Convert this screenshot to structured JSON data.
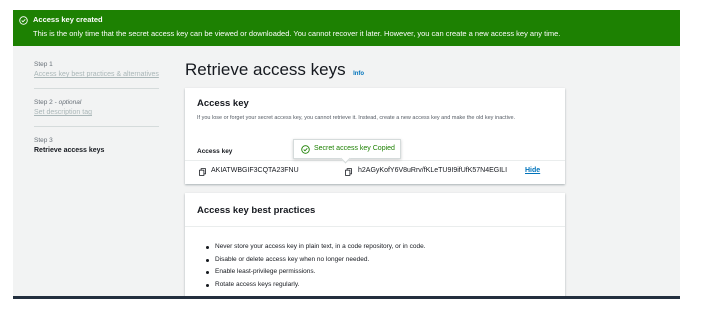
{
  "banner": {
    "title": "Access key created",
    "message": "This is the only time that the secret access key can be viewed or downloaded. You cannot recover it later. However, you can create a new access key any time.",
    "icon": "check-circle-icon",
    "color": "#1d8102"
  },
  "steps": [
    {
      "number": "Step 1",
      "label": "Access key best practices & alternatives"
    },
    {
      "number": "Step 2",
      "optional": "optional",
      "label": "Set description tag"
    },
    {
      "number": "Step 3",
      "label": "Retrieve access keys"
    }
  ],
  "page": {
    "title": "Retrieve access keys",
    "info": "Info"
  },
  "access_key_card": {
    "heading": "Access key",
    "description": "If you lose or forget your secret access key, you cannot retrieve it. Instead, create a new access key and make the old key inactive.",
    "column_header": "Access key",
    "access_key_id": "AKIATWBGIF3CQTA23FNU",
    "secret_access_key": "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",
    "hide_label": "Hide",
    "copy_icon": "copy-icon"
  },
  "tooltip": {
    "text": "Secret access key Copied",
    "icon": "check-circle-icon"
  },
  "best_practices_card": {
    "heading": "Access key best practices",
    "items": [
      "Never store your access key in plain text, in a code repository, or in code.",
      "Disable or delete access key when no longer needed.",
      "Enable least-privilege permissions.",
      "Rotate access keys regularly."
    ]
  },
  "colors": {
    "link": "#0073bb",
    "success": "#1d8102",
    "background": "#f2f3f3"
  }
}
